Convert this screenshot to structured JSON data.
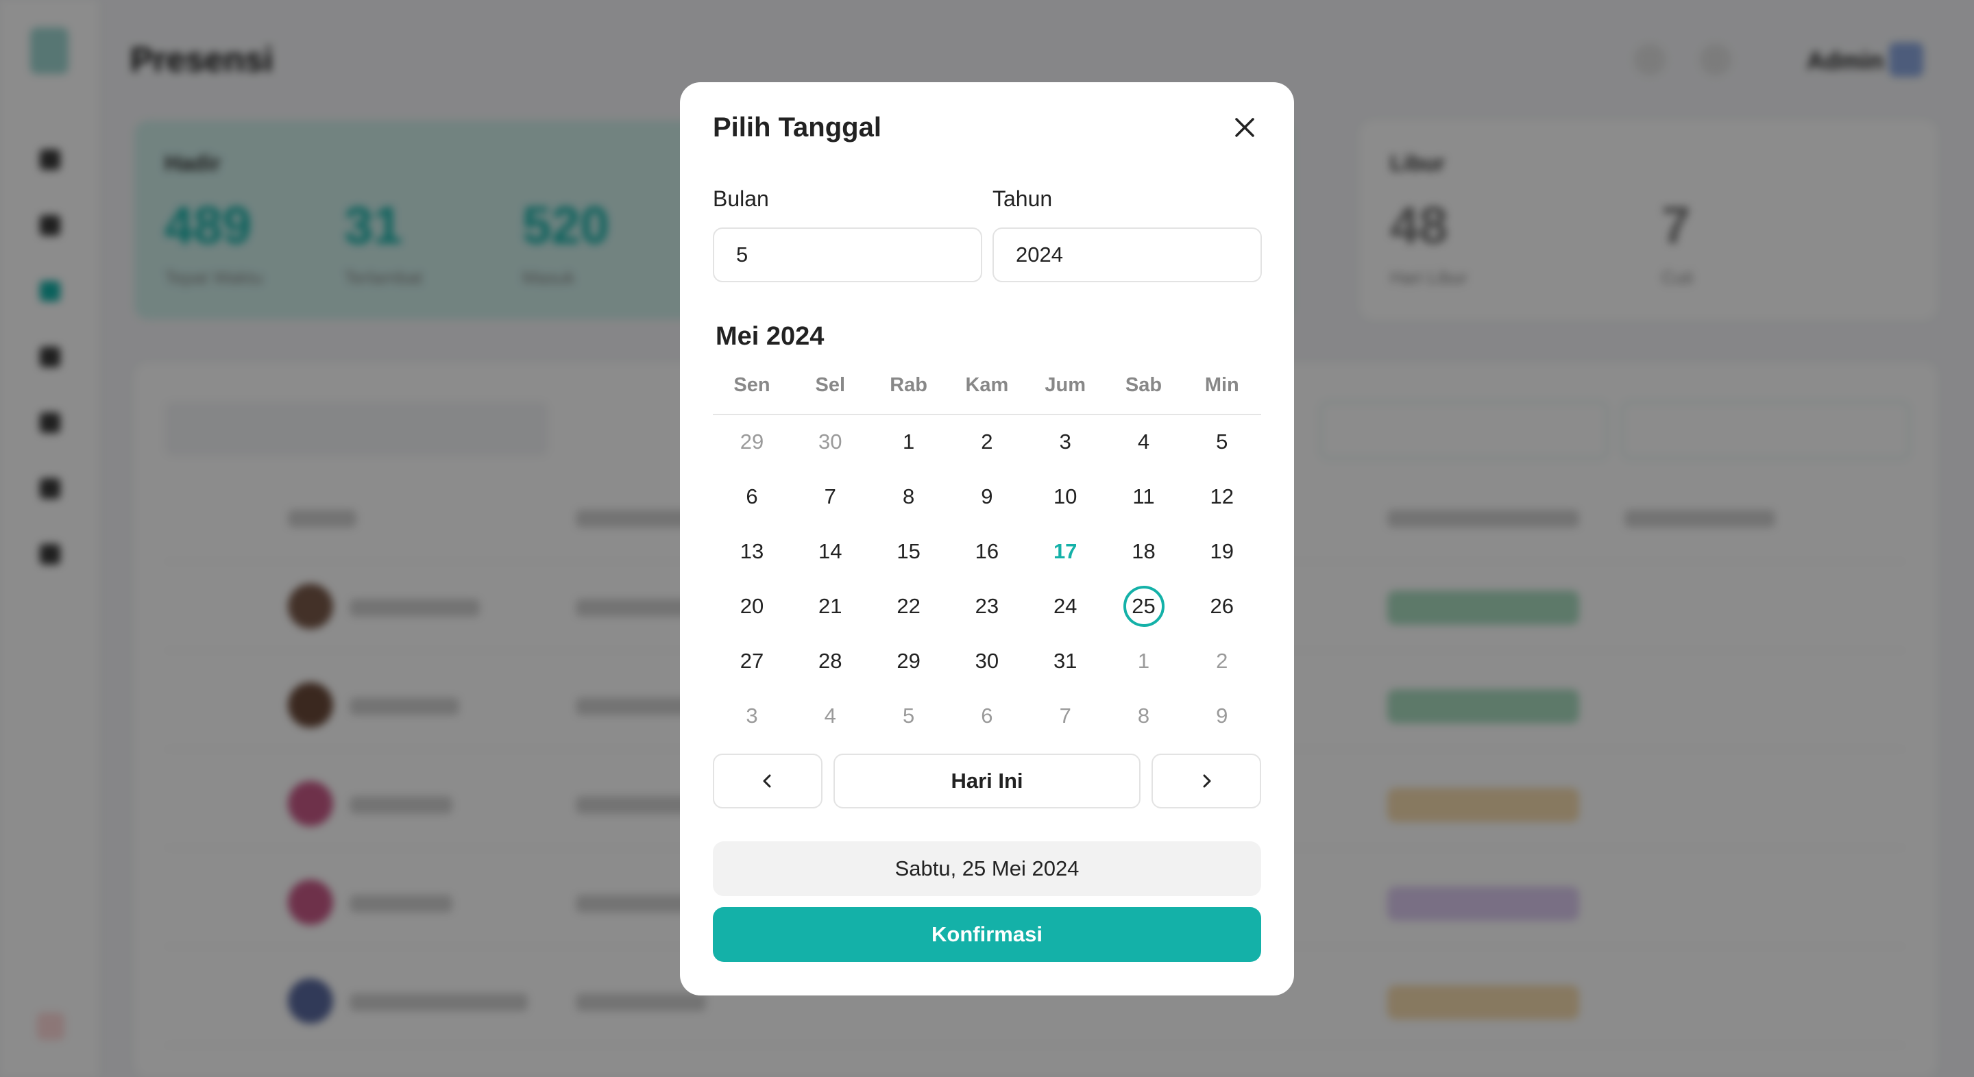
{
  "background": {
    "page_title": "Presensi",
    "admin_name": "Admin",
    "stat_cards": [
      {
        "label": "Hadir",
        "items": [
          {
            "value": "489",
            "caption": "Tepat Waktu"
          },
          {
            "value": "31",
            "caption": "Terlambat"
          },
          {
            "value": "520",
            "caption": "Masuk"
          }
        ]
      },
      {
        "label": "Libur",
        "items": [
          {
            "value": "48",
            "caption": "Hari Libur"
          },
          {
            "value": "7",
            "caption": "Cuti"
          }
        ]
      }
    ]
  },
  "modal": {
    "title": "Pilih Tanggal",
    "month_label": "Bulan",
    "year_label": "Tahun",
    "month_value": "5",
    "year_value": "2024",
    "calendar_title": "Mei 2024",
    "weekdays": [
      "Sen",
      "Sel",
      "Rab",
      "Kam",
      "Jum",
      "Sab",
      "Min"
    ],
    "weeks": [
      [
        "29",
        "30",
        "1",
        "2",
        "3",
        "4",
        "5"
      ],
      [
        "6",
        "7",
        "8",
        "9",
        "10",
        "11",
        "12"
      ],
      [
        "13",
        "14",
        "15",
        "16",
        "17",
        "18",
        "19"
      ],
      [
        "20",
        "21",
        "22",
        "23",
        "24",
        "25",
        "26"
      ],
      [
        "27",
        "28",
        "29",
        "30",
        "31",
        "1",
        "2"
      ],
      [
        "3",
        "4",
        "5",
        "6",
        "7",
        "8",
        "9"
      ]
    ],
    "today_day": "17",
    "selected_day": "25",
    "today_button": "Hari Ini",
    "selected_date_text": "Sabtu, 25 Mei 2024",
    "confirm_button": "Konfirmasi",
    "accent_color": "#14b1a8"
  }
}
